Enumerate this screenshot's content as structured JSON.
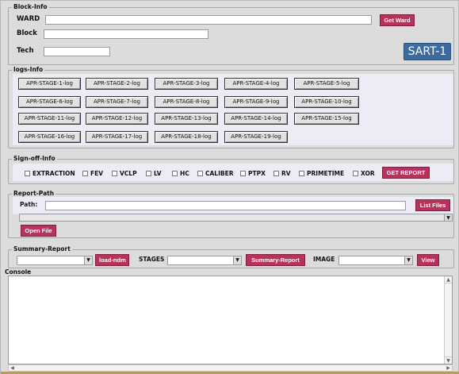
{
  "block_info": {
    "frame_title": "Block-Info",
    "ward_label": "WARD",
    "ward_value": "",
    "get_ward_button": "Get Ward",
    "block_label": "Block",
    "block_value": "",
    "tech_label": "Tech",
    "tech_value": "",
    "sart_badge": "SART-1"
  },
  "logs_info": {
    "frame_title": "logs-Info",
    "buttons": [
      "APR-STAGE-1-log",
      "APR-STAGE-2-log",
      "APR-STAGE-3-log",
      "APR-STAGE-4-log",
      "APR-STAGE-5-log",
      "APR-STAGE-6-log",
      "APR-STAGE-7-log",
      "APR-STAGE-8-log",
      "APR-STAGE-9-log",
      "APR-STAGE-10-log",
      "APR-STAGE-11-log",
      "APR-STAGE-12-log",
      "APR-STAGE-13-log",
      "APR-STAGE-14-log",
      "APR-STAGE-15-log",
      "APR-STAGE-16-log",
      "APR-STAGE-17-log",
      "APR-STAGE-18-log",
      "APR-STAGE-19-log"
    ]
  },
  "signoff_info": {
    "frame_title": "Sign-off-Info",
    "checks": [
      "EXTRACTION",
      "FEV",
      "VCLP",
      "LV",
      "HC",
      "CALIBER",
      "PTPX",
      "RV",
      "PRIMETIME",
      "XOR"
    ],
    "get_report_button": "GET REPORT"
  },
  "report_path": {
    "frame_title": "Report-Path",
    "path_label": "Path:",
    "path_value": "",
    "list_files_button": "List Files",
    "open_file_button": "Open File"
  },
  "summary_report": {
    "frame_title": "Summary-Report",
    "load_ndm_button": "load-ndm",
    "stages_label": "STAGES",
    "summary_report_button": "Summary-Report",
    "image_label": "IMAGE",
    "view_button": "View"
  },
  "console": {
    "frame_title": "Console"
  },
  "colors": {
    "accent_red": "#b8325c",
    "badge_blue": "#3b6b9f",
    "panel_lavender": "#ececf6",
    "window_gray": "#dcdcdc"
  }
}
